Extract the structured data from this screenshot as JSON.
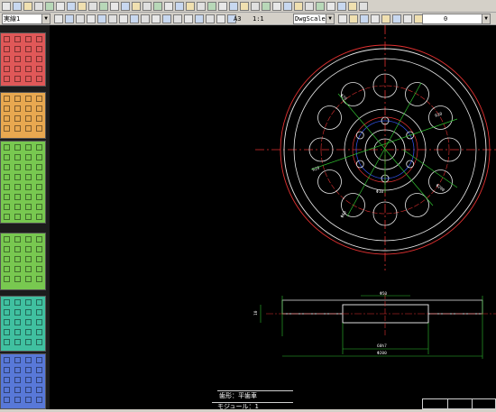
{
  "toolbar": {
    "layer_combo": "実線1",
    "paper_size": "A3",
    "scale": "1:1",
    "scale_mode": "DwgScale",
    "layer_number": "0"
  },
  "drawing": {
    "dimensions": {
      "front_hole_circle": "Φ70",
      "front_radius_a": "R30",
      "front_radius_b": "R20",
      "front_diameter": "Φ200",
      "front_diameter_2": "Φ60",
      "front_hole": "Φ10",
      "side_top": "Φ50",
      "side_width": "60h7",
      "side_overall": "Φ200",
      "side_left": "10"
    },
    "title_block": {
      "shape_label": "歯形：平歯車",
      "module_label": "モジュール：1"
    }
  },
  "colors": {
    "palette_red": "#e05858",
    "palette_orange": "#e8a850",
    "palette_green": "#78c850",
    "palette_teal": "#40c0a0",
    "palette_blue": "#5878d8",
    "canvas_bg": "#000000"
  }
}
